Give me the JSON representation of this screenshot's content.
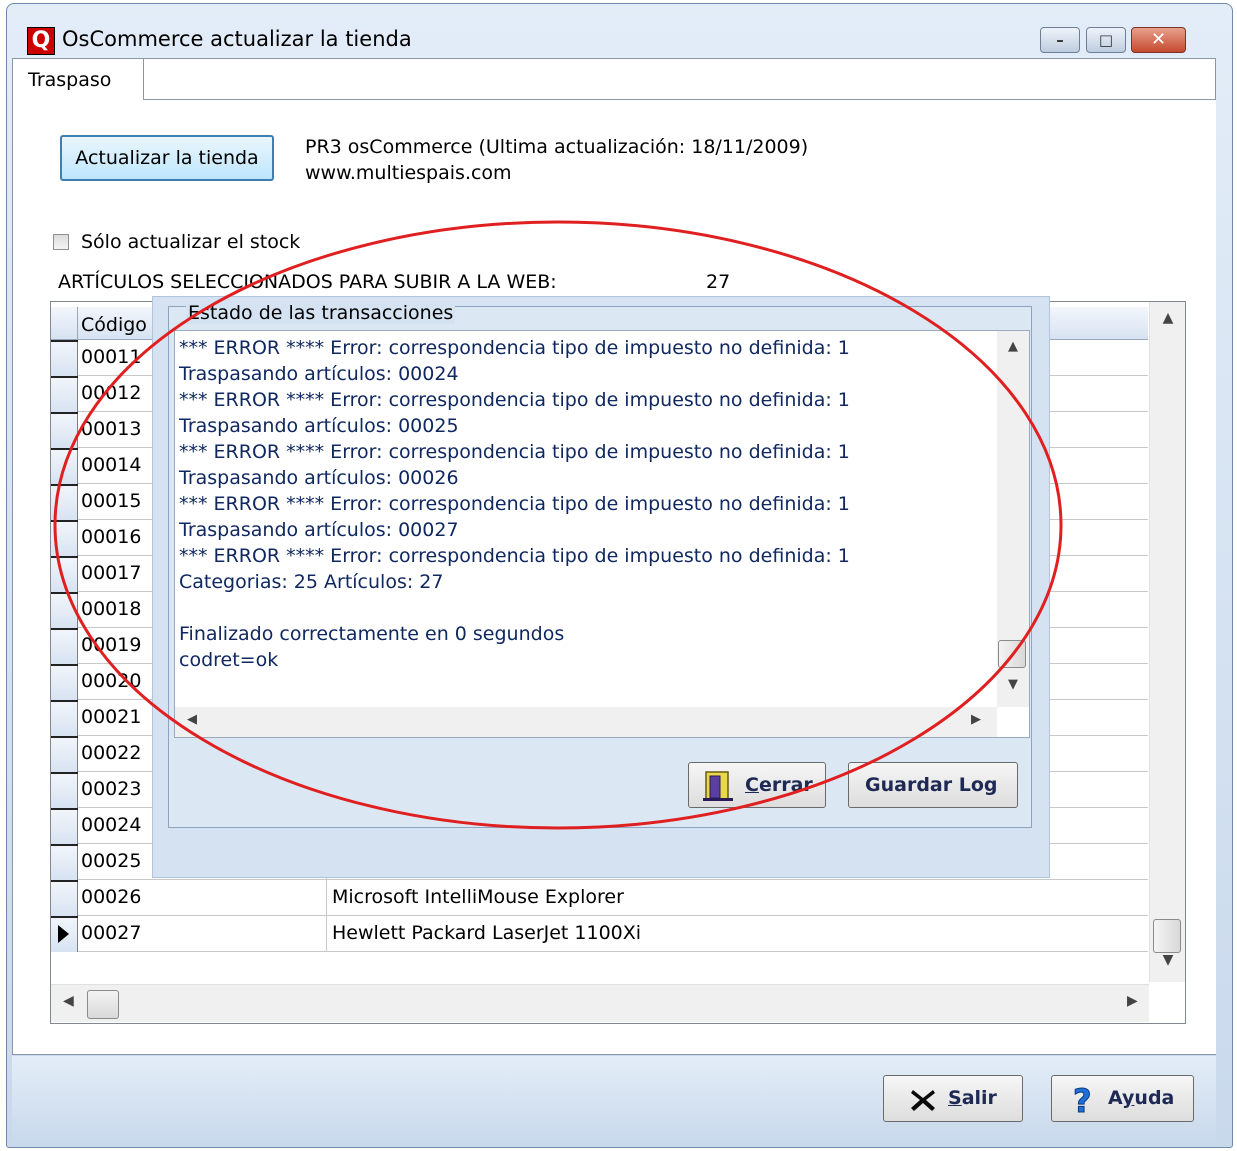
{
  "window": {
    "title": "OsCommerce actualizar la tienda",
    "app_icon_letter": "Q",
    "controls": {
      "minimize": "–",
      "maximize": "□",
      "close": "✕"
    }
  },
  "tabs": [
    {
      "label": "Traspaso",
      "active": true
    }
  ],
  "main": {
    "update_button": "Actualizar la tienda",
    "shop_info": "PR3 osCommerce  (Ultima actualización: 18/11/2009)",
    "shop_url": "www.multiespais.com",
    "stock_only_label": "Sólo actualizar el stock",
    "stock_only_checked": false,
    "selected_label": "ARTÍCULOS SELECCIONADOS PARA SUBIR A LA WEB:",
    "selected_count": "27"
  },
  "grid": {
    "header_code": "Código",
    "rows": [
      {
        "code": "00011",
        "desc": ""
      },
      {
        "code": "00012",
        "desc": ""
      },
      {
        "code": "00013",
        "desc": ""
      },
      {
        "code": "00014",
        "desc": ""
      },
      {
        "code": "00015",
        "desc": ""
      },
      {
        "code": "00016",
        "desc": ""
      },
      {
        "code": "00017",
        "desc": ""
      },
      {
        "code": "00018",
        "desc": ""
      },
      {
        "code": "00019",
        "desc": ""
      },
      {
        "code": "00020",
        "desc": ""
      },
      {
        "code": "00021",
        "desc": ""
      },
      {
        "code": "00022",
        "desc": ""
      },
      {
        "code": "00023",
        "desc": ""
      },
      {
        "code": "00024",
        "desc": ""
      },
      {
        "code": "00025",
        "desc": ""
      },
      {
        "code": "00026",
        "desc": "Microsoft IntelliMouse Explorer"
      },
      {
        "code": "00027",
        "desc": "Hewlett Packard LaserJet 1100Xi",
        "current": true
      }
    ]
  },
  "dialog": {
    "title": "Estado de las transacciones",
    "log": [
      "*** ERROR **** Error: correspondencia tipo de impuesto no definida: 1",
      "Traspasando artículos: 00024",
      "*** ERROR **** Error: correspondencia tipo de impuesto no definida: 1",
      "Traspasando artículos: 00025",
      "*** ERROR **** Error: correspondencia tipo de impuesto no definida: 1",
      "Traspasando artículos: 00026",
      "*** ERROR **** Error: correspondencia tipo de impuesto no definida: 1",
      "Traspasando artículos: 00027",
      "*** ERROR **** Error: correspondencia tipo de impuesto no definida: 1",
      "Categorias: 25 Artículos: 27",
      "",
      "Finalizado correctamente en 0 segundos",
      "codret=ok"
    ],
    "close_button": {
      "accel": "C",
      "rest": "errar"
    },
    "save_button": "Guardar Log"
  },
  "footer": {
    "exit_button": {
      "accel": "S",
      "rest": "alir"
    },
    "help_button": {
      "pre": "A",
      "accel": "y",
      "rest": "uda"
    }
  },
  "colors": {
    "annotation": "#e02020",
    "log_text": "#102860"
  }
}
